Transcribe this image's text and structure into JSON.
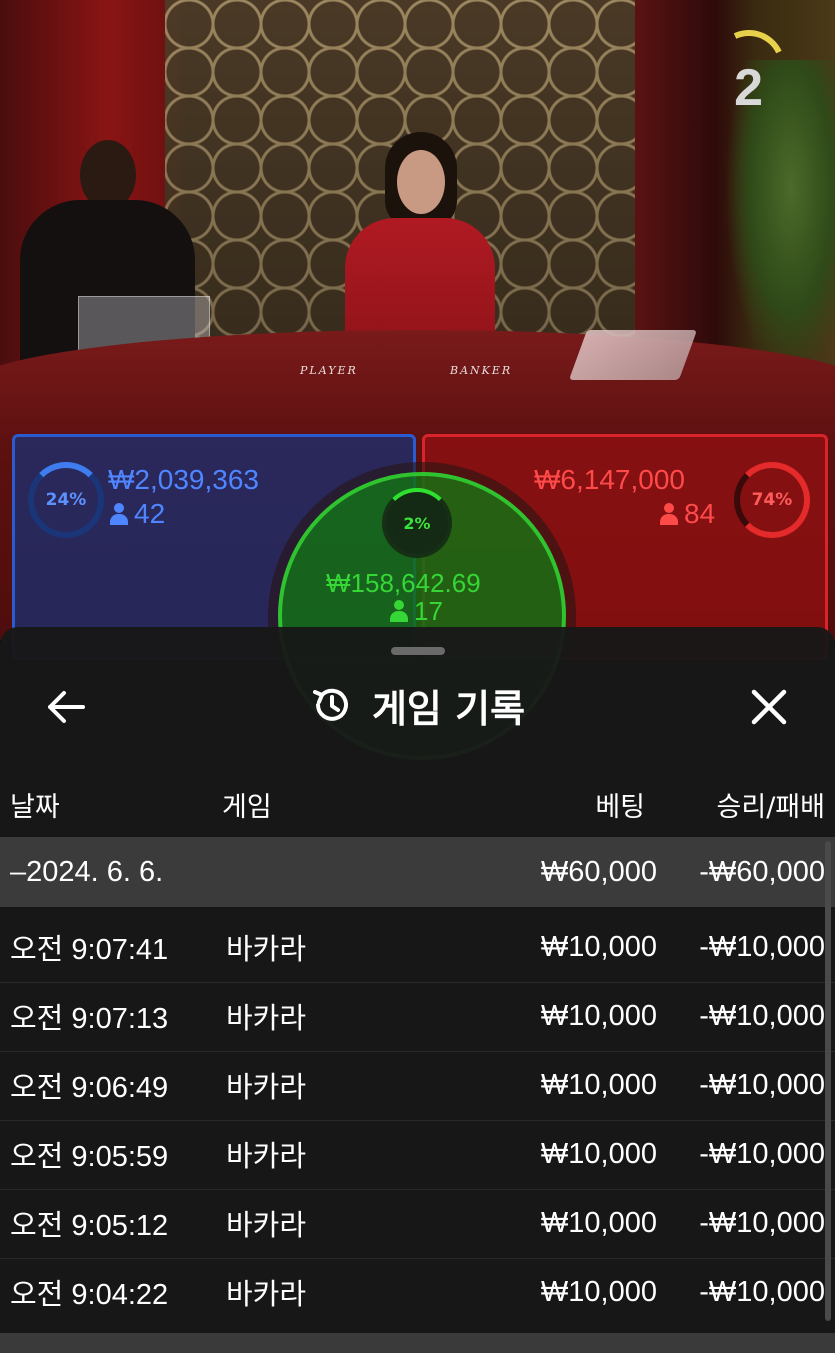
{
  "round": {
    "number": "2"
  },
  "table_labels": {
    "player": "PLAYER",
    "banker": "BANKER"
  },
  "bets": {
    "player": {
      "percent": "24%",
      "amount": "₩2,039,363",
      "count": "42",
      "color": "#4f86ff"
    },
    "banker": {
      "percent": "74%",
      "amount": "₩6,147,000",
      "count": "84",
      "color": "#ff4a4a"
    },
    "tie": {
      "percent": "2%",
      "amount": "₩158,642.69",
      "count": "17",
      "color": "#35d635"
    }
  },
  "sheet": {
    "title": "게임 기록",
    "icons": {
      "back": "arrow-left-icon",
      "history": "history-icon",
      "close": "close-icon"
    },
    "columns": {
      "date": "날짜",
      "game": "게임",
      "bet": "베팅",
      "result": "승리/패배"
    },
    "date_group": {
      "label": "–2024. 6. 6.",
      "bet": "₩60,000",
      "result": "-₩60,000"
    },
    "rows": [
      {
        "time": "오전 9:07:41",
        "game": "바카라",
        "bet": "₩10,000",
        "result": "-₩10,000"
      },
      {
        "time": "오전 9:07:13",
        "game": "바카라",
        "bet": "₩10,000",
        "result": "-₩10,000"
      },
      {
        "time": "오전 9:06:49",
        "game": "바카라",
        "bet": "₩10,000",
        "result": "-₩10,000"
      },
      {
        "time": "오전 9:05:59",
        "game": "바카라",
        "bet": "₩10,000",
        "result": "-₩10,000"
      },
      {
        "time": "오전 9:05:12",
        "game": "바카라",
        "bet": "₩10,000",
        "result": "-₩10,000"
      },
      {
        "time": "오전 9:04:22",
        "game": "바카라",
        "bet": "₩10,000",
        "result": "-₩10,000"
      }
    ]
  }
}
